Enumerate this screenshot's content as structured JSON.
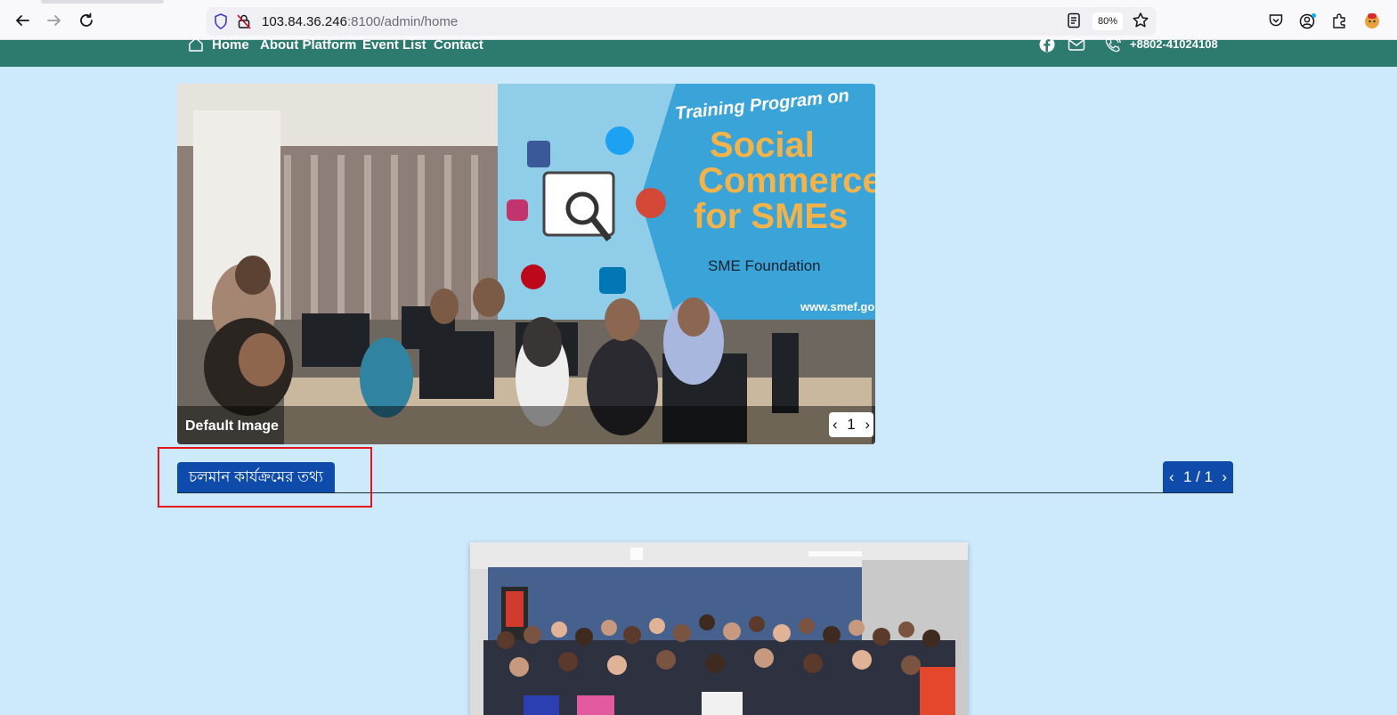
{
  "browser": {
    "url_host": "103.84.36.246",
    "url_rest": ":8100/admin/home",
    "zoom": "80%"
  },
  "header": {
    "nav": [
      "Home",
      "About Platform",
      "Event List",
      "Contact"
    ],
    "phone": "+8802-41024108"
  },
  "hero": {
    "caption": "Default Image",
    "page": "1",
    "banner": {
      "line1": "Training Program on",
      "line2": "Social",
      "line3": "Commerce",
      "line4": "for SMEs",
      "org": "SME Foundation",
      "url": "www.smef.go"
    }
  },
  "section": {
    "title": "চলমান কার্যক্রমের তথ্য",
    "pager": "1 / 1"
  },
  "icons": {
    "back": "arrow-left-icon",
    "forward": "arrow-right-icon",
    "reload": "reload-icon",
    "home": "home-icon",
    "facebook": "facebook-icon",
    "mail": "mail-icon",
    "phone": "phone-icon"
  },
  "colors": {
    "page_bg": "#cdeafd",
    "header_bg": "#2d7a6e",
    "accent_blue": "#0f4bab",
    "highlight": "#e8141c"
  }
}
